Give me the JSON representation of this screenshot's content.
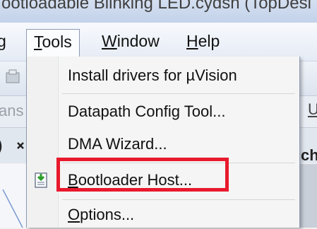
{
  "window": {
    "title_fragment": "ootloadable Blinking LED.cydsn (TopDesi"
  },
  "menubar": {
    "partial_item": "g",
    "items": [
      {
        "label_pre": "",
        "label_ul": "T",
        "label_post": "ools"
      },
      {
        "label_pre": "",
        "label_ul": "W",
        "label_post": "indow"
      },
      {
        "label_pre": "",
        "label_ul": "H",
        "label_post": "elp"
      }
    ]
  },
  "background": {
    "toolbar_fragment": "ans",
    "pane_fragment": ")",
    "right_fragment": "U",
    "tab_fragment": "ch"
  },
  "tools_menu": {
    "items": [
      {
        "pre": "Install drivers for µVision",
        "ul": "",
        "post": ""
      },
      {
        "pre": "Datapath Config Tool",
        "ul": "",
        "post": "..."
      },
      {
        "pre": "DMA Wizard...",
        "ul": "",
        "post": ""
      },
      {
        "pre": "",
        "ul": "B",
        "post": "ootloader Host..."
      },
      {
        "pre": "",
        "ul": "O",
        "post": "ptions..."
      }
    ],
    "datapath_mnemonic": "g"
  },
  "icons": {
    "bootloader": "bootloader-host-icon"
  },
  "colors": {
    "highlight": "#e8192c",
    "menu_bg": "#f5f5f5",
    "menu_border": "#8d9ab0"
  }
}
